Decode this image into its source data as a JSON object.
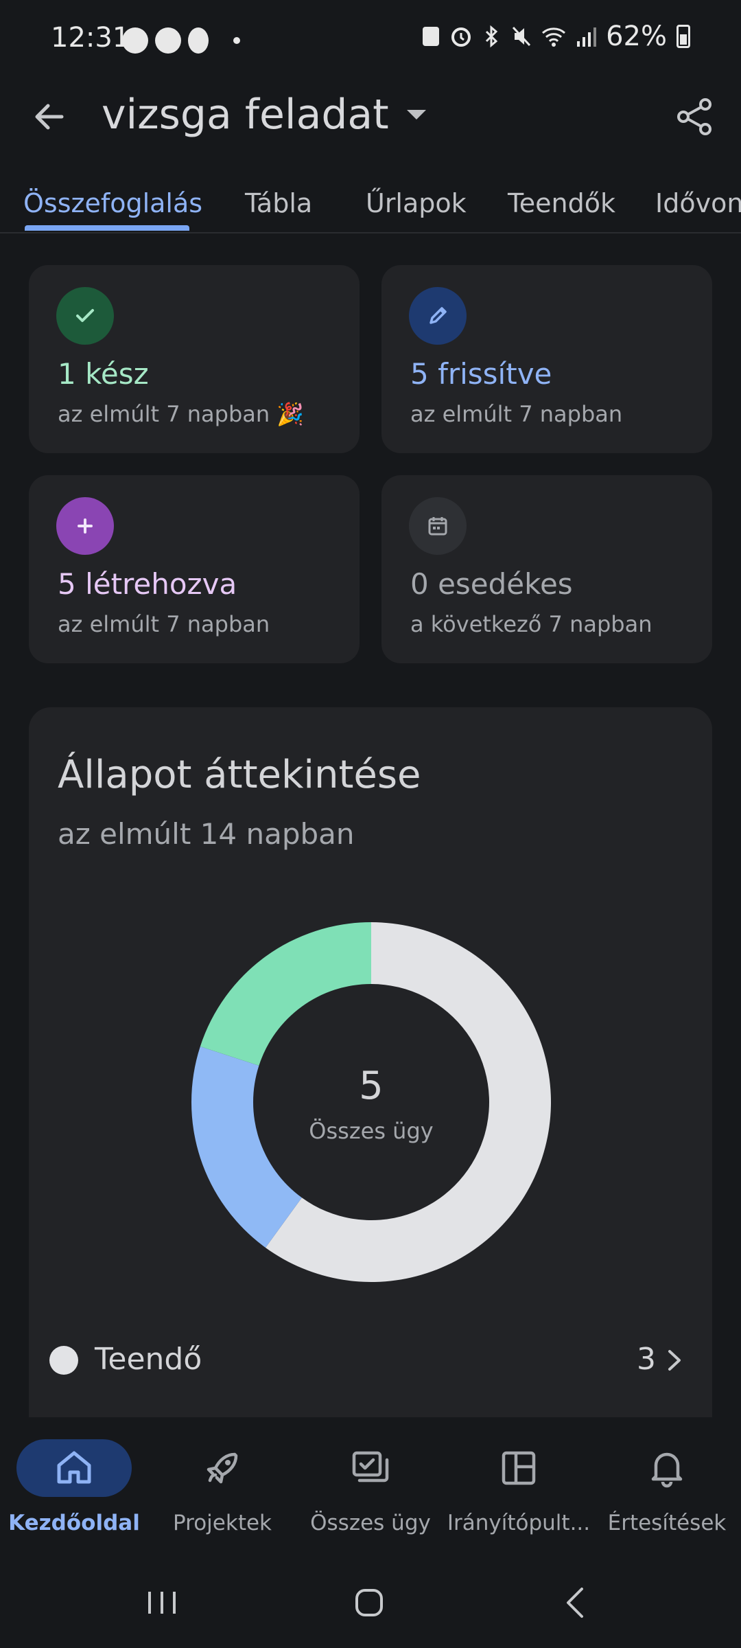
{
  "status_bar": {
    "time": "12:31",
    "battery": "62%"
  },
  "app_bar": {
    "title": "vizsga feladat"
  },
  "tabs": [
    {
      "label": "Összefoglalás",
      "active": true
    },
    {
      "label": "Tábla",
      "active": false
    },
    {
      "label": "Űrlapok",
      "active": false
    },
    {
      "label": "Teendők",
      "active": false
    },
    {
      "label": "Idővona",
      "active": false
    }
  ],
  "cards": {
    "done": {
      "value": "1 kész",
      "period": "az elmúlt 7 napban 🎉",
      "color": "#a6e8c6",
      "icon_bg": "#1d5a3a"
    },
    "updated": {
      "value": "5 frissítve",
      "period": "az elmúlt 7 napban",
      "color": "#8fb3f5",
      "icon_bg": "#1e3a70"
    },
    "created": {
      "value": "5 létrehozva",
      "period": "az elmúlt 7 napban",
      "color": "#e6c8f5",
      "icon_bg": "#8a45b3"
    },
    "due": {
      "value": "0 esedékes",
      "period": "a következő 7 napban",
      "color": "#a5a8ad",
      "icon_bg": "#2e3034"
    }
  },
  "overview": {
    "title": "Állapot áttekintése",
    "subtitle": "az elmúlt 14 napban",
    "total": "5",
    "total_label": "Összes ügy",
    "legend": [
      {
        "label": "Teendő",
        "count": "3",
        "color": "#e2e3e6"
      }
    ]
  },
  "chart_data": {
    "type": "pie",
    "series": [
      {
        "name": "Teendő",
        "values": [
          3
        ],
        "color": "#e2e3e6"
      },
      {
        "values": [
          1
        ],
        "color": "#8fb9f5"
      },
      {
        "values": [
          1
        ],
        "color": "#7fe0b6"
      }
    ],
    "total": 5
  },
  "bottom_nav": [
    {
      "label": "Kezdőoldal",
      "icon": "home-icon",
      "active": true
    },
    {
      "label": "Projektek",
      "icon": "rocket-icon",
      "active": false
    },
    {
      "label": "Összes ügy",
      "icon": "issues-icon",
      "active": false
    },
    {
      "label": "Irányítópult...",
      "icon": "dashboard-icon",
      "active": false
    },
    {
      "label": "Értesítések",
      "icon": "bell-icon",
      "active": false
    }
  ]
}
